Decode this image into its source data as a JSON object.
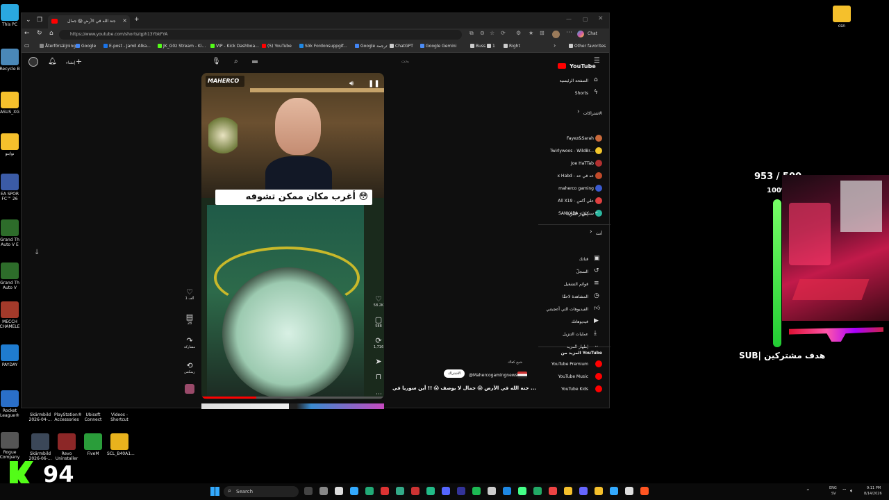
{
  "desktop": {
    "icons_left": [
      {
        "label": "This PC",
        "color": "#2aa8e0"
      },
      {
        "label": "Recycle B",
        "color": "#4a88b8"
      },
      {
        "label": "ASUS_XG",
        "color": "#f5c02c"
      },
      {
        "label": "نوابتو",
        "color": "#f5c02c"
      },
      {
        "label": "EA SPOR FC™ 26",
        "color": "#3b5ba6"
      },
      {
        "label": "Grand Th Auto V E",
        "color": "#2d6c2a"
      },
      {
        "label": "Grand Th Auto V",
        "color": "#2d6c2a"
      },
      {
        "label": "MECCH CHAMELE",
        "color": "#a33a2a"
      },
      {
        "label": "PAYDAY",
        "color": "#1f7cd0"
      },
      {
        "label": "Rocket League®",
        "color": "#2a6fc9"
      },
      {
        "label": "Rogue Company",
        "color": "#555"
      }
    ],
    "icons_bottom": [
      {
        "label": "Skärmbild 2026-04-...",
        "color": "#3b4758"
      },
      {
        "label": "PlayStation® Accessories",
        "color": "#1e3f8c"
      },
      {
        "label": "Ubisoft Connect",
        "color": "#1f5fc9"
      },
      {
        "label": "Videos - Shortcut",
        "color": "#1d1d1d"
      },
      {
        "label": "Skärmbild 2026-06-...",
        "color": "#3b4758"
      },
      {
        "label": "Revo Uninstaller",
        "color": "#8c2727"
      },
      {
        "label": "FiveM",
        "color": "#2a9d3a"
      },
      {
        "label": "SCL_B40A1...",
        "color": "#e8b21d"
      }
    ],
    "icon_right_label": "csn"
  },
  "browser": {
    "tab_title": "جنة الله في الأرض 😱 جمال",
    "url": "https://www.youtube.com/shorts/qph13YbkFYA",
    "chat_label": "Chat",
    "favorites": [
      "Återförsäljning",
      "Google",
      "E-post - Jamil Alka...",
      "JK_G0z Stream - Ki...",
      "VIP - Kick Dashboa...",
      "(5) YouTube",
      "Sök Fordonsuppgif...",
      "Google ترجمة",
      "ChatGPT",
      "Google Gemini",
      "Buss",
      "1",
      "Right"
    ],
    "other_favorites": "Other favorites"
  },
  "youtube": {
    "logo_text": "YouTube",
    "create_label": "إنشاء",
    "search_placeholder": "بحث",
    "sidebar": {
      "home": "الصفحة الرئيسية",
      "shorts": "Shorts",
      "subscriptions_header": "الاشتراكات",
      "subscriptions": [
        {
          "name": "Fayez&Sarah",
          "color": "#c96a3b"
        },
        {
          "name": "Twirlywoos - WildBr...",
          "color": "#f3c62b"
        },
        {
          "name": "Joe HaTTab",
          "color": "#b23030"
        },
        {
          "name": "x Habd - عد في حد",
          "color": "#c04a2a"
        },
        {
          "name": "maherco gaming",
          "color": "#3a5ad0"
        },
        {
          "name": "All X19 - علي أكس",
          "color": "#e04040"
        },
        {
          "name": "SANKARA - سنكارا",
          "color": "#2bb7a0"
        }
      ],
      "show_more_1": "إظهار المزيد",
      "you_header": "أنت",
      "you_items": [
        "قناتك",
        "السجلّ",
        "قوائم التشغيل",
        "المشاهدة لاحقًا",
        "الفيديوهات التي أعجبتني",
        "فيديوهاتك",
        "عمليات التنزيل",
        "إظهار المزيد"
      ],
      "more_header": "المزيد من YouTube",
      "more_items": [
        {
          "name": "YouTube Premium",
          "color": "#ff0000"
        },
        {
          "name": "YouTube Music",
          "color": "#ff0000"
        },
        {
          "name": "YouTube Kids",
          "color": "#ff0000"
        }
      ]
    },
    "short": {
      "channel_watermark": "MAHERCO",
      "caption_overlay": "أغرب مكان ممكن تشوفه 😳",
      "likes": "58.2K",
      "comments": "588",
      "shares": "1,716",
      "channel": "@Mahercogamingnews",
      "subscribe": "الاشتراك",
      "title": "جنة الله في الأرض 😱 جمال لا يوصف 😱 !! أين سوريا في ...",
      "sound_label": "شيخ كفاك"
    },
    "previous_short": {
      "likes": "1 ألف",
      "comments": "28",
      "share": "مشاركة",
      "remix": "ريمكس"
    }
  },
  "overlay": {
    "sub_count": "953 / 500",
    "sub_percent": "100%",
    "sub_progress": 1.0,
    "sub_label": "SUB| هدف مشتركين",
    "kick_count": "94"
  },
  "taskbar": {
    "search_label": "Search",
    "lang_top": "ENG",
    "lang_bottom": "SV",
    "time": "9:11 PM",
    "date": "8/14/2026"
  }
}
